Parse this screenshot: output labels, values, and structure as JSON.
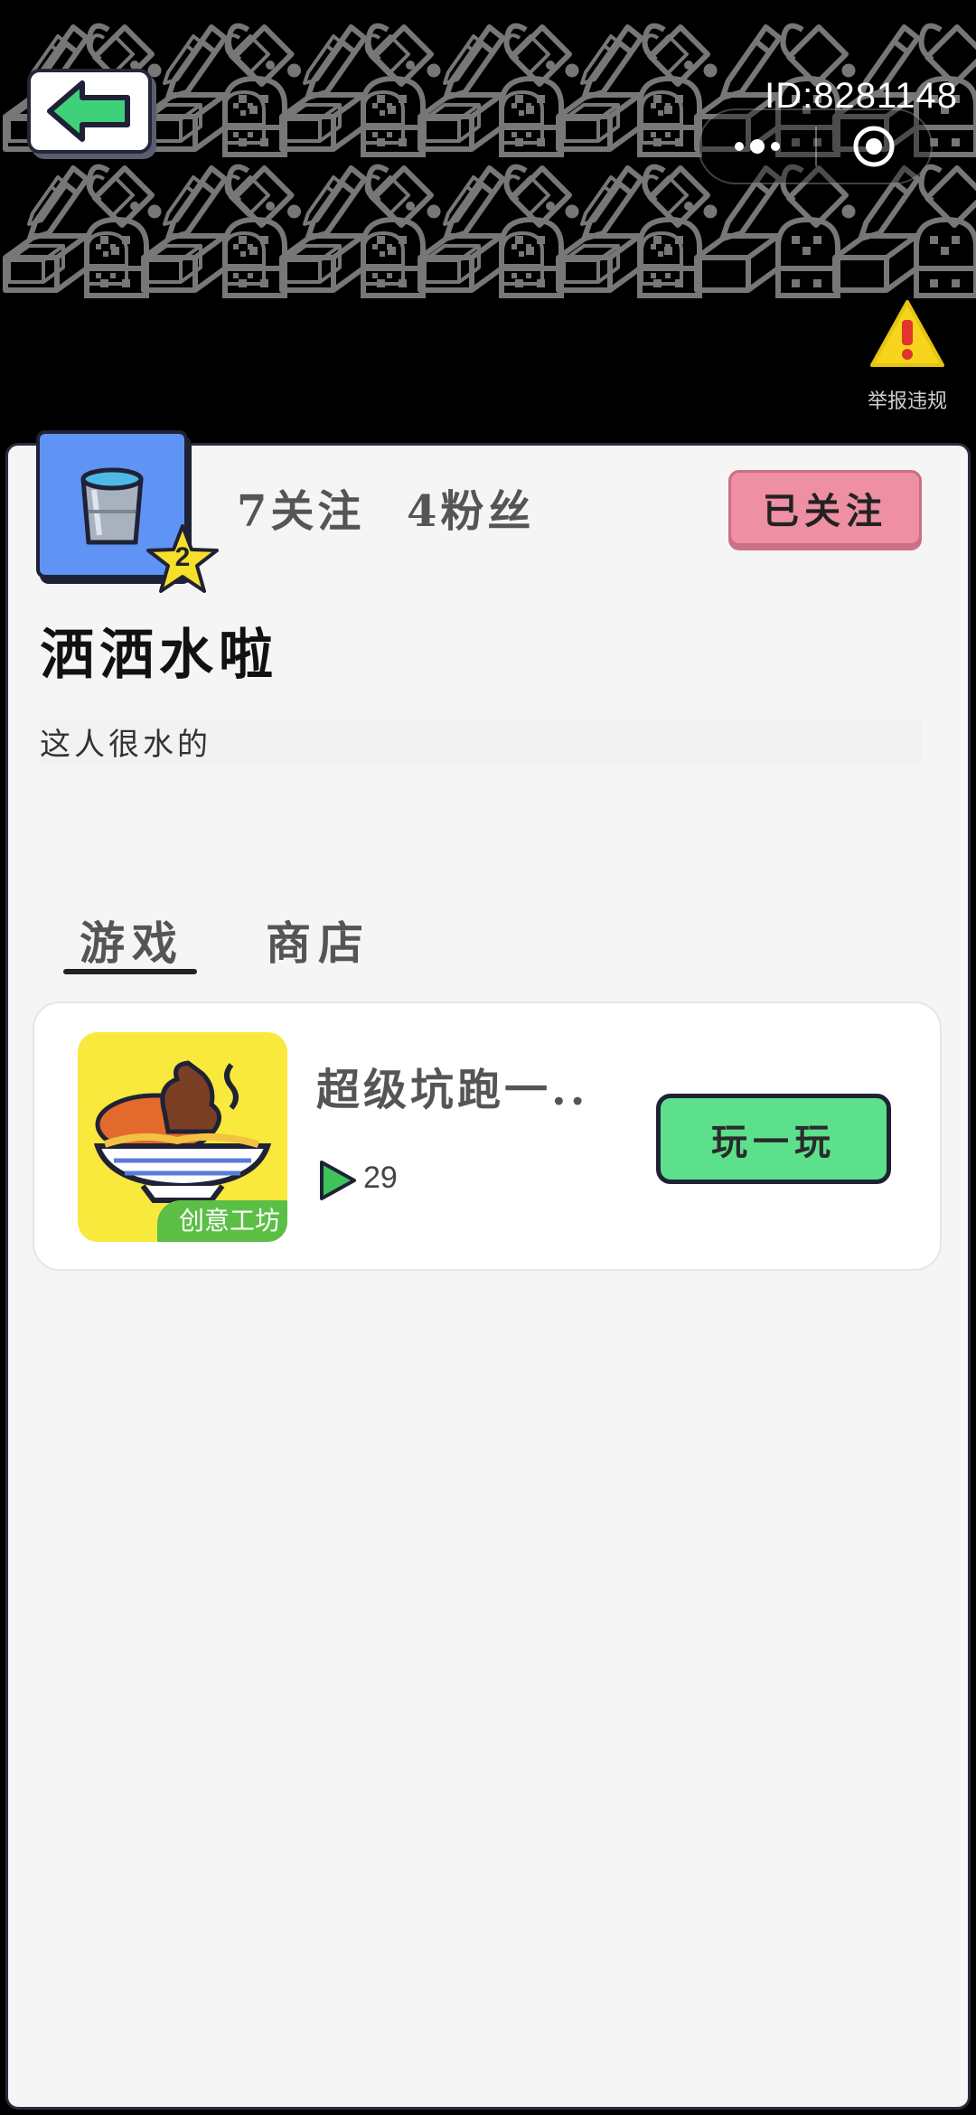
{
  "header": {
    "user_id": "ID:8281148",
    "report_label": "举报违规"
  },
  "profile": {
    "following": "7关注",
    "followers": "4粉丝",
    "follow_button": "已关注",
    "level": "2",
    "username": "洒洒水啦",
    "bio": "这人很水的"
  },
  "tabs": [
    {
      "label": "游戏",
      "active": true
    },
    {
      "label": "商店",
      "active": false
    }
  ],
  "games": [
    {
      "title": "超级坑跑一..",
      "badge": "创意工坊",
      "play_count": "29",
      "play_button": "玩一玩"
    }
  ],
  "colors": {
    "header_bg": "#000000",
    "avatar_bg": "#5f93f4",
    "follow_btn": "#ee8fa4",
    "play_btn": "#5de08c",
    "back_arrow": "#3fd17a"
  },
  "icons": [
    "back-arrow-icon",
    "more-dots-icon",
    "close-target-icon",
    "warning-icon",
    "bucket-icon",
    "star-icon",
    "play-triangle-icon"
  ]
}
